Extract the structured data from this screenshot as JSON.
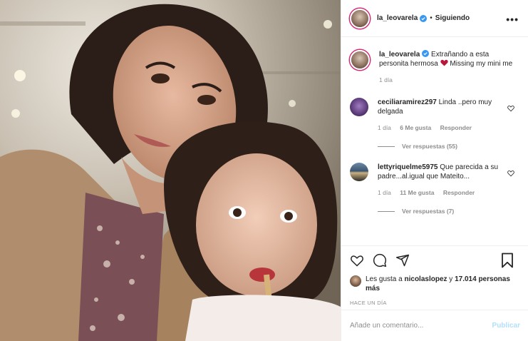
{
  "post": {
    "author": "la_leovarela",
    "verified": true,
    "follow_status": "Siguiendo",
    "separator": "•",
    "more": "•••"
  },
  "caption": {
    "author": "la_leovarela",
    "text_before": "Extrañando a esta personita hermosa",
    "emoji": "heart-icon",
    "text_after": "Missing my mini me",
    "time": "1 día"
  },
  "comments": [
    {
      "user": "ceciliaramirez297",
      "text": "Linda ..pero muy delgada",
      "time": "1 día",
      "likes": "6 Me gusta",
      "reply": "Responder",
      "view_replies": "Ver respuestas (55)"
    },
    {
      "user": "lettyriquelme5975",
      "text": "Que parecida a su padre...al.igual que Mateito...",
      "time": "1 día",
      "likes": "11 Me gusta",
      "reply": "Responder",
      "view_replies": "Ver respuestas (7)"
    }
  ],
  "likes": {
    "prefix": "Les gusta a",
    "user": "nicolaslopez",
    "conj": "y",
    "count": "17.014 personas más"
  },
  "time_ago": "HACE UN DÍA",
  "add_comment": {
    "placeholder": "Añade un comentario...",
    "publish": "Publicar"
  },
  "colors": {
    "accent_verified": "#3897f0",
    "publish_disabled": "#b2dffc",
    "heart_emoji": "#b8163a"
  }
}
